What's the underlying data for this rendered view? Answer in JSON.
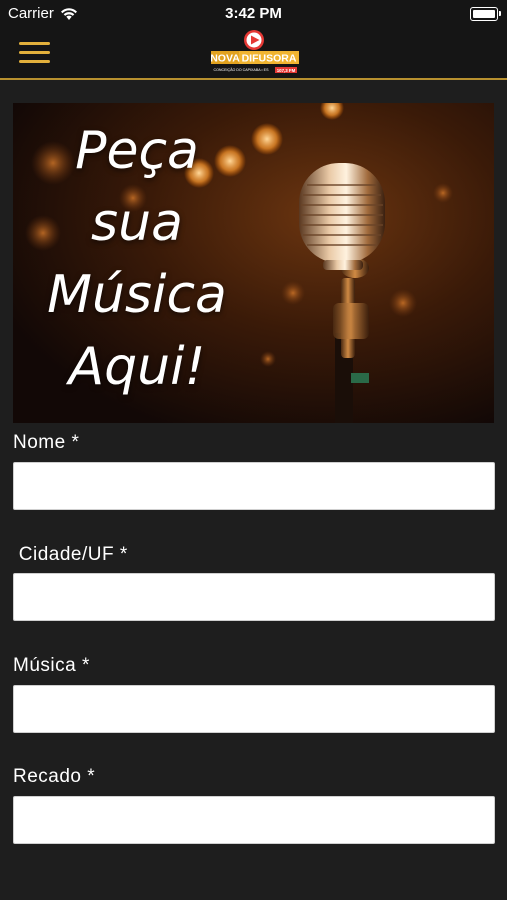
{
  "status_bar": {
    "carrier": "Carrier",
    "time": "3:42 PM"
  },
  "navbar": {
    "menu_icon": "hamburger-menu-icon",
    "logo": {
      "brand_line1": "NOVA",
      "brand_line2": "DIFUSORA",
      "tagline": "CONCEIÇÃO DO CAPIXABA • ES",
      "frequency": "107,3 FM"
    },
    "accent_color": "#e2b03c"
  },
  "banner": {
    "lines": [
      "Peça",
      "sua",
      "Música",
      "Aqui!"
    ]
  },
  "form": {
    "fields": [
      {
        "label": "Nome *",
        "value": "",
        "placeholder": ""
      },
      {
        "label": " Cidade/UF *",
        "value": "",
        "placeholder": ""
      },
      {
        "label": "Música *",
        "value": "",
        "placeholder": ""
      },
      {
        "label": "Recado *",
        "value": "",
        "placeholder": ""
      }
    ]
  }
}
